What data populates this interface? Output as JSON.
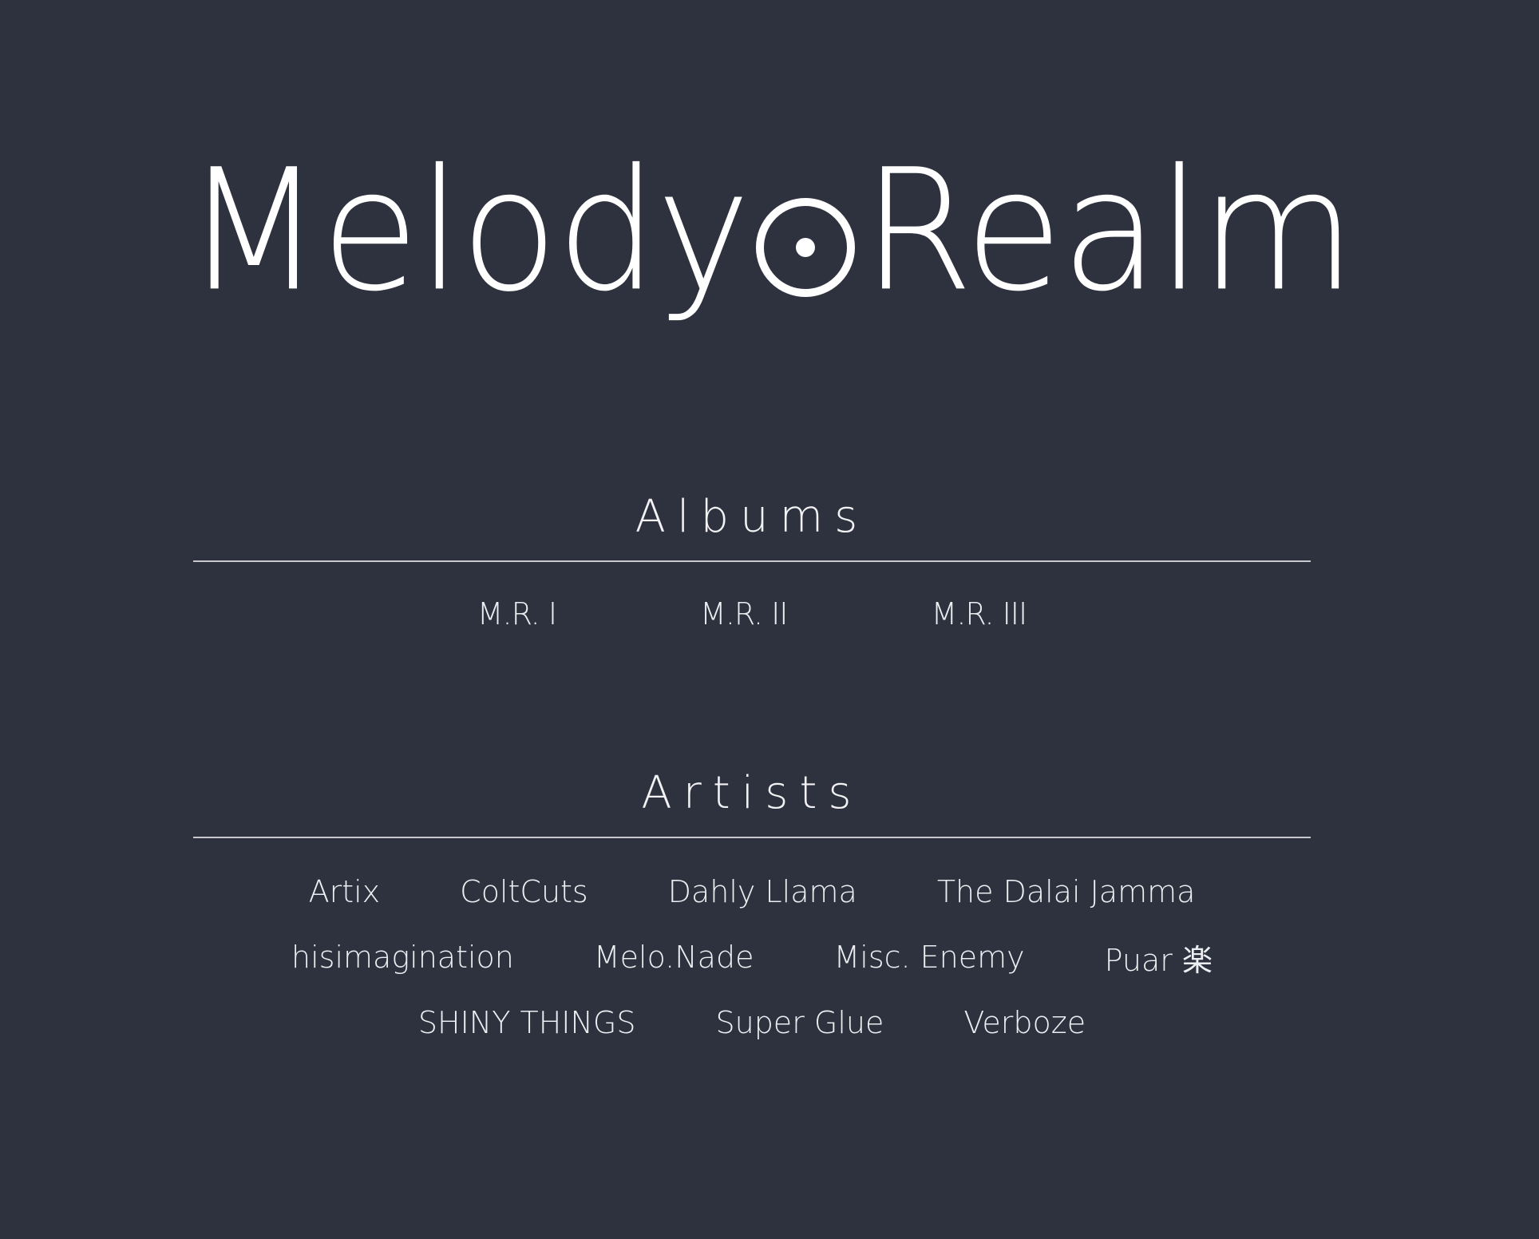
{
  "brand": {
    "name_left": "Melody",
    "name_right": "Realm",
    "logo_mark_icon": "vinyl-record-icon"
  },
  "albums": {
    "title": "Albums",
    "items": [
      "M.R. I",
      "M.R. II",
      "M.R. III"
    ]
  },
  "artists": {
    "title": "Artists",
    "rows": [
      [
        "Artix",
        "ColtCuts",
        "Dahly Llama",
        "The Dalai Jamma"
      ],
      [
        "hisimagination",
        "Melo.Nade",
        "Misc. Enemy",
        "Puar 楽"
      ],
      [
        "SHINY THINGS",
        "Super Glue",
        "Verboze"
      ]
    ]
  },
  "colors": {
    "background": "#2e323e",
    "text": "#f2f2f4",
    "divider": "#c7c9cf"
  }
}
